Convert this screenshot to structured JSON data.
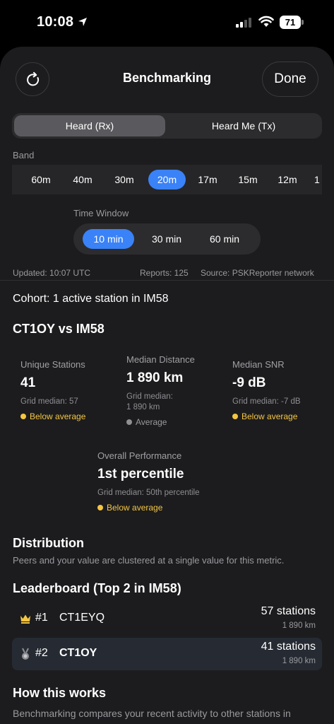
{
  "status": {
    "time": "10:08",
    "battery": "71"
  },
  "nav": {
    "title": "Benchmarking",
    "done": "Done"
  },
  "segment": {
    "rx": "Heard (Rx)",
    "tx": "Heard Me (Tx)"
  },
  "band": {
    "label": "Band",
    "options": [
      "60m",
      "40m",
      "30m",
      "20m",
      "17m",
      "15m",
      "12m",
      "1"
    ],
    "selected": "20m"
  },
  "time_window": {
    "label": "Time Window",
    "options": [
      "10 min",
      "30 min",
      "60 min"
    ],
    "selected": "10 min"
  },
  "meta": {
    "updated": "Updated: 10:07 UTC",
    "reports": "Reports: 125",
    "source": "Source: PSKReporter network"
  },
  "cohort": "Cohort: 1 active station in IM58",
  "comparison_title": "CT1OY vs IM58",
  "metrics": {
    "unique": {
      "label": "Unique Stations",
      "value": "41",
      "sub": "Grid median: 57",
      "status": "Below average"
    },
    "distance": {
      "label": "Median Distance",
      "value": "1 890 km",
      "sub1": "Grid median:",
      "sub2": "1 890 km",
      "status": "Average"
    },
    "snr": {
      "label": "Median SNR",
      "value": "-9 dB",
      "sub": "Grid median: -7 dB",
      "status": "Below average"
    },
    "overall": {
      "label": "Overall Performance",
      "value": "1st percentile",
      "sub": "Grid median: 50th percentile",
      "status": "Below average"
    }
  },
  "distribution": {
    "title": "Distribution",
    "text": "Peers and your value are clustered at a single value for this metric."
  },
  "leaderboard": {
    "title": "Leaderboard (Top 2 in IM58)",
    "rows": [
      {
        "rank": "#1",
        "call": "CT1EYQ",
        "stations": "57 stations",
        "distance": "1 890 km",
        "icon": "crown-icon"
      },
      {
        "rank": "#2",
        "call": "CT1OY",
        "stations": "41 stations",
        "distance": "1 890 km",
        "icon": "medal-icon"
      }
    ]
  },
  "how": {
    "title": "How this works",
    "text": "Benchmarking compares your recent activity to other stations in"
  },
  "colors": {
    "accent": "#3a82f7",
    "warning": "#f5c542",
    "neutral": "#8e8e93"
  }
}
